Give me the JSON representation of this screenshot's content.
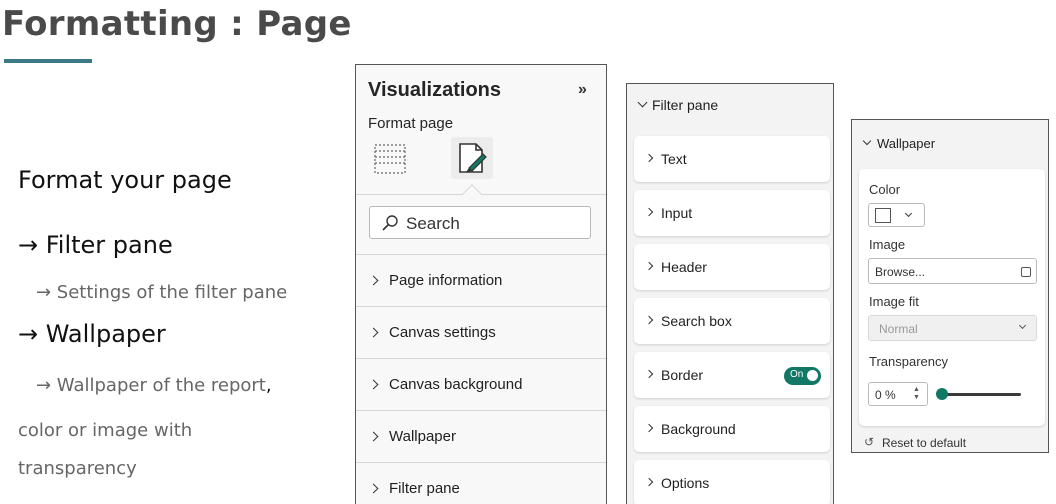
{
  "slide": {
    "title": "Formatting : Page",
    "lines": {
      "format_your_page": "Format your page",
      "filter_pane": "→ Filter pane",
      "filter_pane_sub": "→ Settings of the filter pane",
      "wallpaper": "→ Wallpaper",
      "wallpaper_sub": "→ Wallpaper of the report",
      "wallpaper_sub_comma": ",",
      "color_line": "color or image with",
      "transparency_line": "transparency"
    },
    "accent_color": "#3c7886"
  },
  "visualizations": {
    "title": "Visualizations",
    "collapse_glyph": "»",
    "subtitle": "Format page",
    "search_placeholder": "Search",
    "items": [
      {
        "label": "Page information"
      },
      {
        "label": "Canvas settings"
      },
      {
        "label": "Canvas background"
      },
      {
        "label": "Wallpaper"
      },
      {
        "label": "Filter pane"
      }
    ]
  },
  "filter_pane": {
    "header": "Filter pane",
    "cards": [
      {
        "label": "Text"
      },
      {
        "label": "Input"
      },
      {
        "label": "Header"
      },
      {
        "label": "Search box"
      },
      {
        "label": "Border",
        "toggle": "On"
      },
      {
        "label": "Background"
      },
      {
        "label": "Options"
      }
    ],
    "toggle_color": "#117865"
  },
  "wallpaper": {
    "header": "Wallpaper",
    "color_label": "Color",
    "color_value": "#ffffff",
    "image_label": "Image",
    "image_value": "Browse...",
    "image_fit_label": "Image fit",
    "image_fit_value": "Normal",
    "transparency_label": "Transparency",
    "transparency_value": "0 %",
    "transparency_fraction": 0,
    "reset_label": "Reset to default"
  }
}
